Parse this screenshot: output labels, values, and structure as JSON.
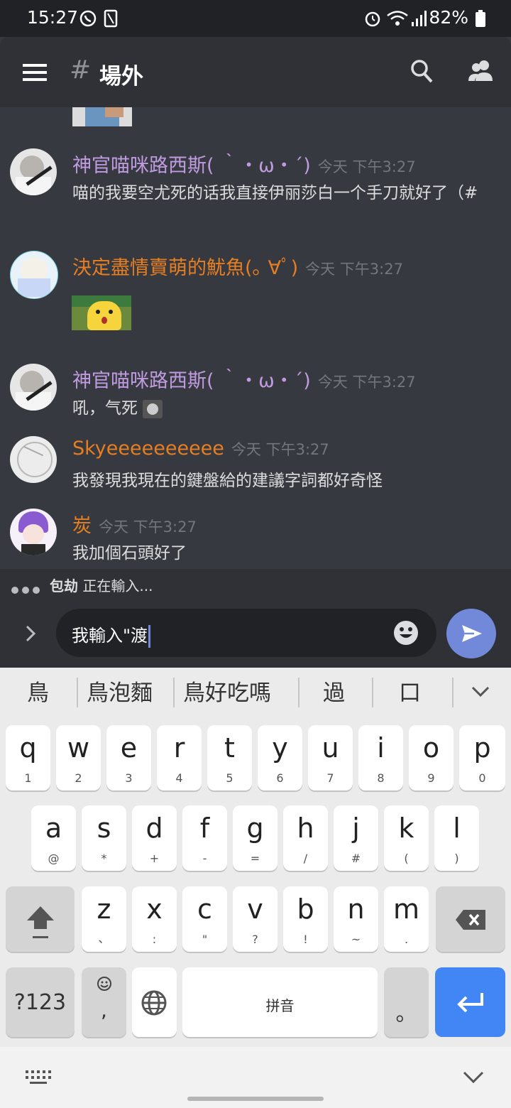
{
  "status": {
    "time": "15:27",
    "battery": "82%"
  },
  "header": {
    "title": "場外"
  },
  "messages": [
    {
      "user": "神官喵咪路西斯( ｀・ω・´)",
      "time": "今天 下午3:27",
      "text": "喵的我要空尤死的话我直接伊丽莎白一个手刀就好了（#",
      "color": "#c09be0"
    },
    {
      "user": "決定盡情賣萌的魷魚(｡ ∀ﾟ)",
      "time": "今天 下午3:27",
      "text": "",
      "color": "#e67e22"
    },
    {
      "user": "神官喵咪路西斯( ｀・ω・´)",
      "time": "今天 下午3:27",
      "text": "吼，气死",
      "color": "#c09be0"
    },
    {
      "user": "Skyeeeeeeeeee",
      "time": "今天 下午3:27",
      "text": "我發現我現在的鍵盤給的建議字詞都好奇怪",
      "color": "#e67e22"
    },
    {
      "user": "炭",
      "time": "今天 下午3:27",
      "text": "我加個石頭好了",
      "color": "#e67e22"
    }
  ],
  "typing": {
    "name": "包劫",
    "text": "正在輸入..."
  },
  "composer": {
    "value": "我輸入\"渡"
  },
  "keyboard": {
    "suggestions": [
      "鳥",
      "鳥泡麵",
      "鳥好吃嗎",
      "過",
      "口"
    ],
    "row1": [
      {
        "k": "q",
        "s": "1"
      },
      {
        "k": "w",
        "s": "2"
      },
      {
        "k": "e",
        "s": "3"
      },
      {
        "k": "r",
        "s": "4"
      },
      {
        "k": "t",
        "s": "5"
      },
      {
        "k": "y",
        "s": "6"
      },
      {
        "k": "u",
        "s": "7"
      },
      {
        "k": "i",
        "s": "8"
      },
      {
        "k": "o",
        "s": "9"
      },
      {
        "k": "p",
        "s": "0"
      }
    ],
    "row2": [
      {
        "k": "a",
        "s": "@"
      },
      {
        "k": "s",
        "s": "*"
      },
      {
        "k": "d",
        "s": "+"
      },
      {
        "k": "f",
        "s": "-"
      },
      {
        "k": "g",
        "s": "="
      },
      {
        "k": "h",
        "s": "/"
      },
      {
        "k": "j",
        "s": "#"
      },
      {
        "k": "k",
        "s": "("
      },
      {
        "k": "l",
        "s": ")"
      }
    ],
    "row3": [
      {
        "k": "z",
        "s": "、"
      },
      {
        "k": "x",
        "s": ":"
      },
      {
        "k": "c",
        "s": "\""
      },
      {
        "k": "v",
        "s": "?"
      },
      {
        "k": "b",
        "s": "!"
      },
      {
        "k": "n",
        "s": "~"
      },
      {
        "k": "m",
        "s": "."
      }
    ],
    "symbols_label": "?123",
    "comma": ",",
    "space_label": "拼音",
    "period": "。"
  },
  "colors": {
    "accent": "#7289da",
    "enter": "#4285f4"
  }
}
